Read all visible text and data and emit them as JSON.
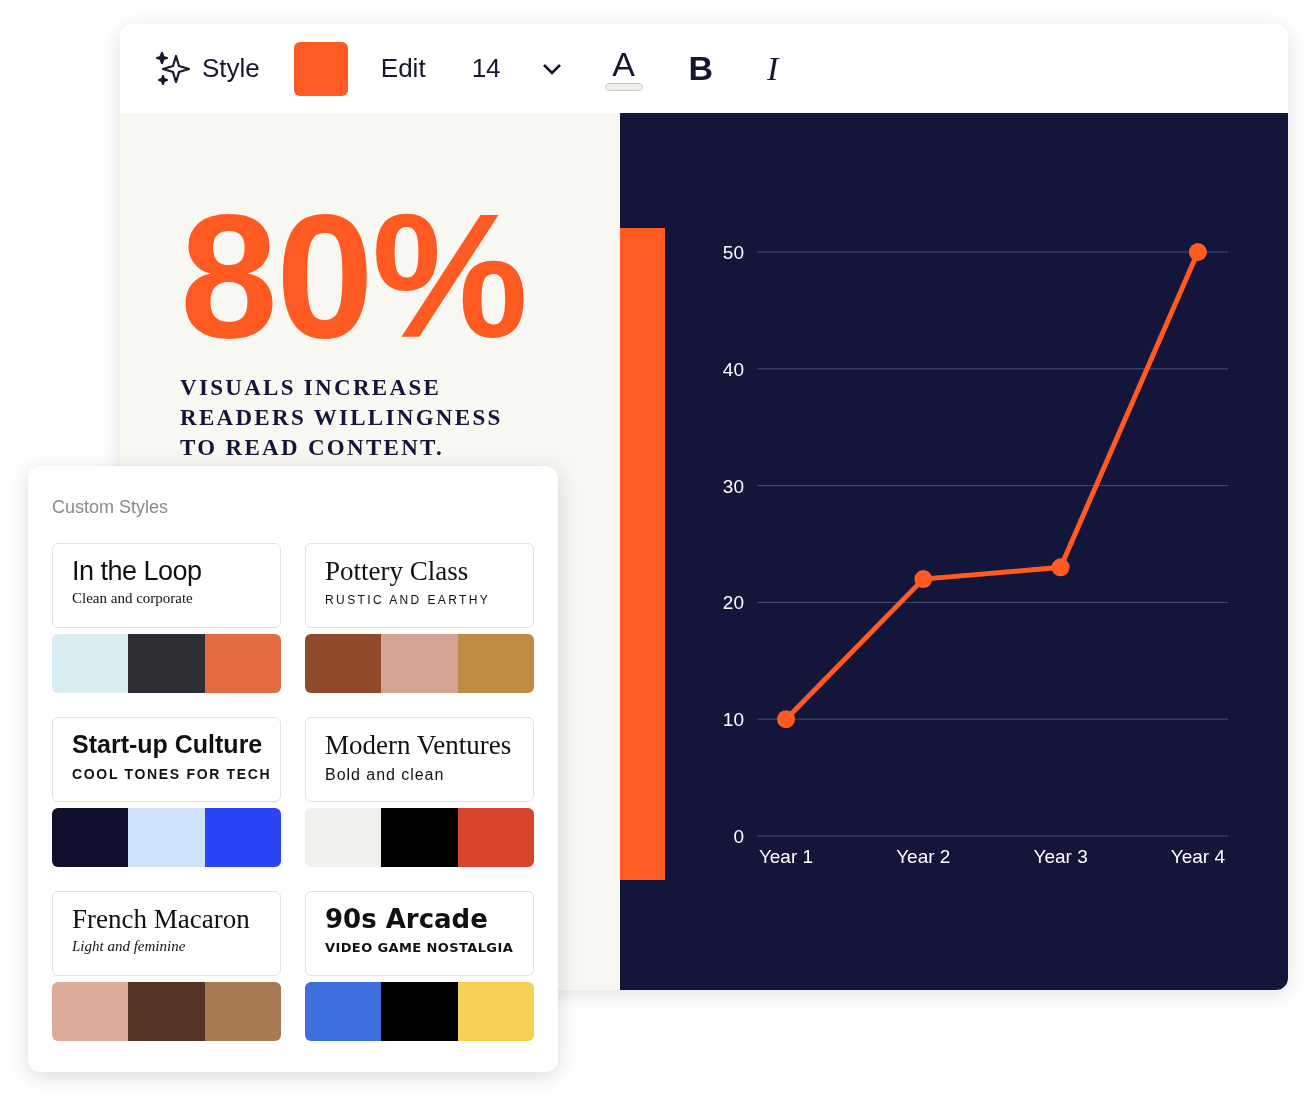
{
  "toolbar": {
    "style_button": "Style",
    "color_swatch": {
      "color": "#ff5a22"
    },
    "edit_button": "Edit",
    "font_size": "14",
    "text_color_button": "A",
    "bold_button": "B",
    "italic_button": "I"
  },
  "slide": {
    "headline": "80%",
    "caption": "VISUALS INCREASE READERS WILLINGNESS TO READ CONTENT.",
    "chart_data": {
      "type": "line",
      "categories": [
        "Year 1",
        "Year 2",
        "Year 3",
        "Year 4"
      ],
      "grid": true,
      "series": [
        {
          "color": "#ff5a22",
          "marker": true,
          "values": [
            10,
            22,
            23,
            50
          ]
        }
      ],
      "ylim": [
        0,
        50
      ],
      "yticks": [
        0,
        10,
        20,
        30,
        40,
        50
      ]
    }
  },
  "custom_styles": {
    "title": "Custom Styles",
    "styles": [
      {
        "name": "In the Loop",
        "subtitle": "Clean and corporate",
        "swatches": [
          {
            "color": "#d9ebf3"
          },
          {
            "color": "#2d2e33"
          },
          {
            "color": "#e26c3f"
          }
        ]
      },
      {
        "name": "Pottery Class",
        "subtitle": "RUSTIC AND EARTHY",
        "swatches": [
          {
            "color": "#8f4a2b"
          },
          {
            "color": "#d3a592"
          },
          {
            "color": "#c08c44"
          }
        ]
      },
      {
        "name": "Start-up Culture",
        "subtitle": "COOL TONES FOR TECH",
        "swatches": [
          {
            "color": "#0d0f2b"
          },
          {
            "color": "#cfe4fb"
          },
          {
            "color": "#2a45f5"
          }
        ]
      },
      {
        "name": "Modern Ventures",
        "subtitle": "Bold and clean",
        "swatches": [
          {
            "color": "#efefeb"
          },
          {
            "color": "#000000"
          },
          {
            "color": "#d9442c"
          }
        ]
      },
      {
        "name": "French Macaron",
        "subtitle": "Light and feminine",
        "swatches": [
          {
            "color": "#dcab9a"
          },
          {
            "color": "#533426"
          },
          {
            "color": "#a87a52"
          }
        ]
      },
      {
        "name": "90s Arcade",
        "subtitle": "VIDEO GAME NOSTALGIA",
        "swatches": [
          {
            "color": "#3e6fdc"
          },
          {
            "color": "#000000"
          },
          {
            "color": "#f6cf57"
          }
        ]
      }
    ]
  }
}
